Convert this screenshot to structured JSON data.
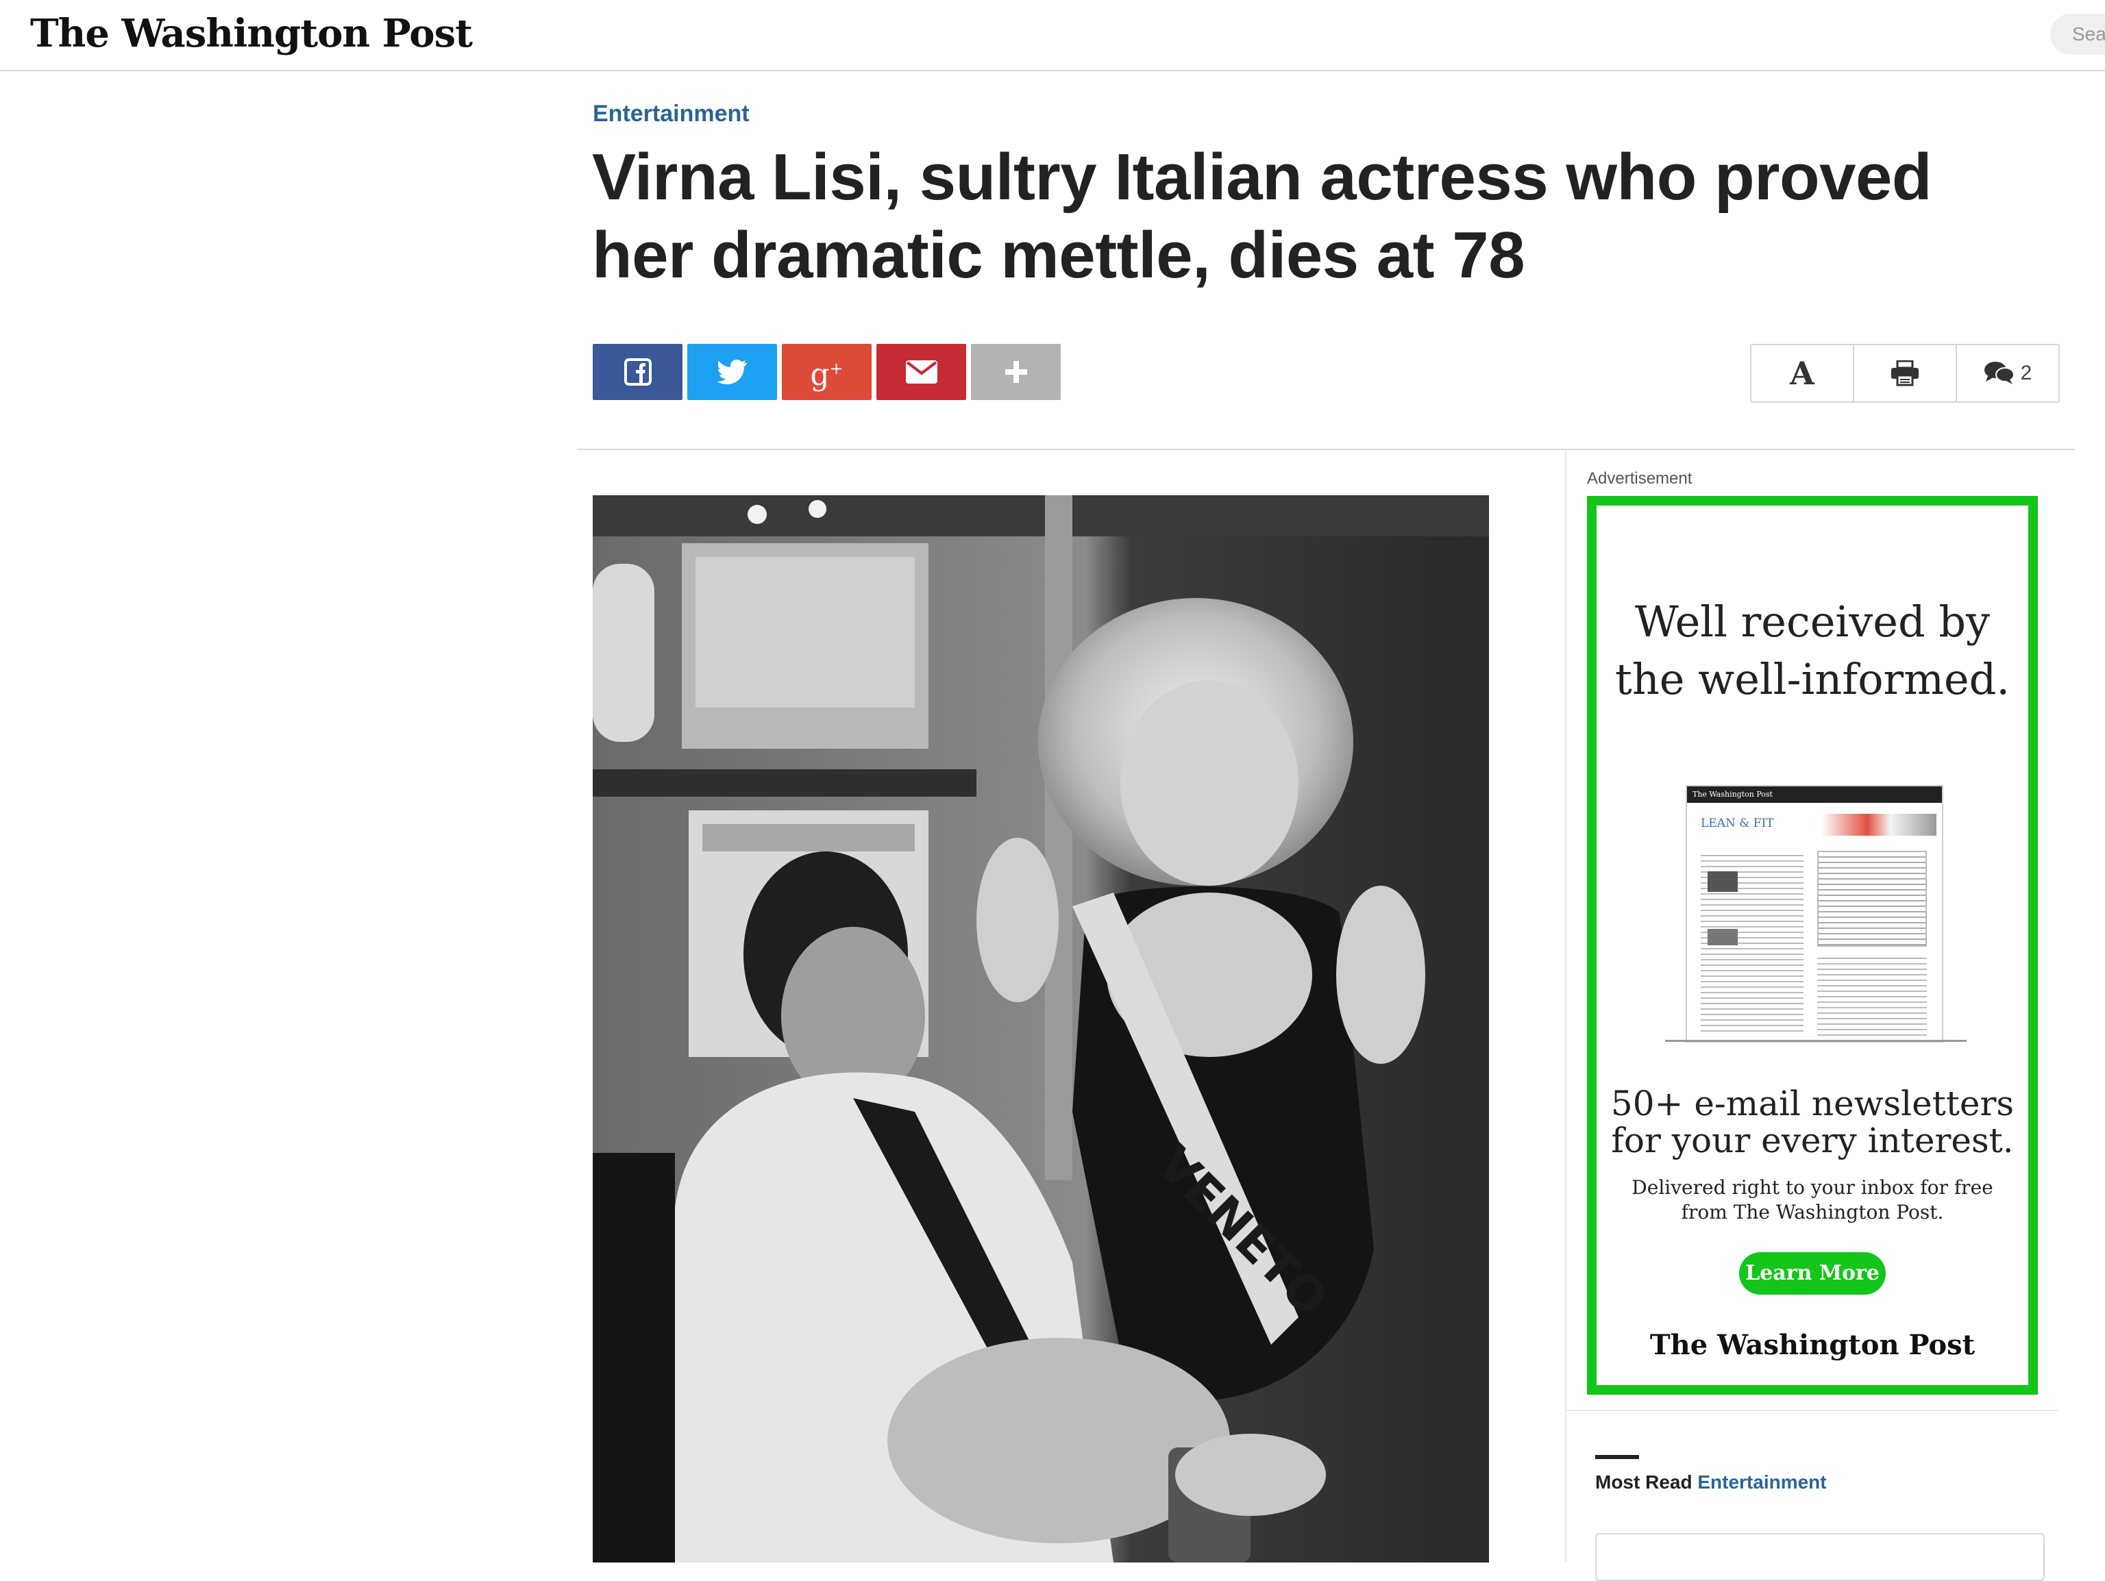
{
  "header": {
    "logo": "The Washington Post",
    "search_placeholder": "Sea"
  },
  "article": {
    "kicker": "Entertainment",
    "headline": "Virna Lisi, sultry Italian actress who proved her dramatic mettle, dies at 78"
  },
  "share": {
    "buttons": [
      "facebook",
      "twitter",
      "google-plus",
      "email",
      "more"
    ],
    "colors": {
      "facebook": "#3b5998",
      "twitter": "#1da1f2",
      "google_plus": "#dd4b39",
      "email": "#c62a32",
      "more": "#b3b3b3"
    }
  },
  "tools": {
    "font_label": "A",
    "comment_count": "2"
  },
  "photo": {
    "sash_text": "VENETO"
  },
  "ad": {
    "label": "Advertisement",
    "headline_line1": "Well received by",
    "headline_line2": "the well-informed.",
    "paper_masthead": "The Washington Post",
    "paper_section": "LEAN & FIT",
    "sub_line1": "50+ e-mail newsletters",
    "sub_line2": "for your every interest.",
    "copy": "Delivered right to your inbox for free from The Washington Post.",
    "button": "Learn More",
    "logo": "The Washington Post",
    "accent_color": "#14c51a"
  },
  "most_read": {
    "label": "Most Read",
    "section": "Entertainment"
  }
}
